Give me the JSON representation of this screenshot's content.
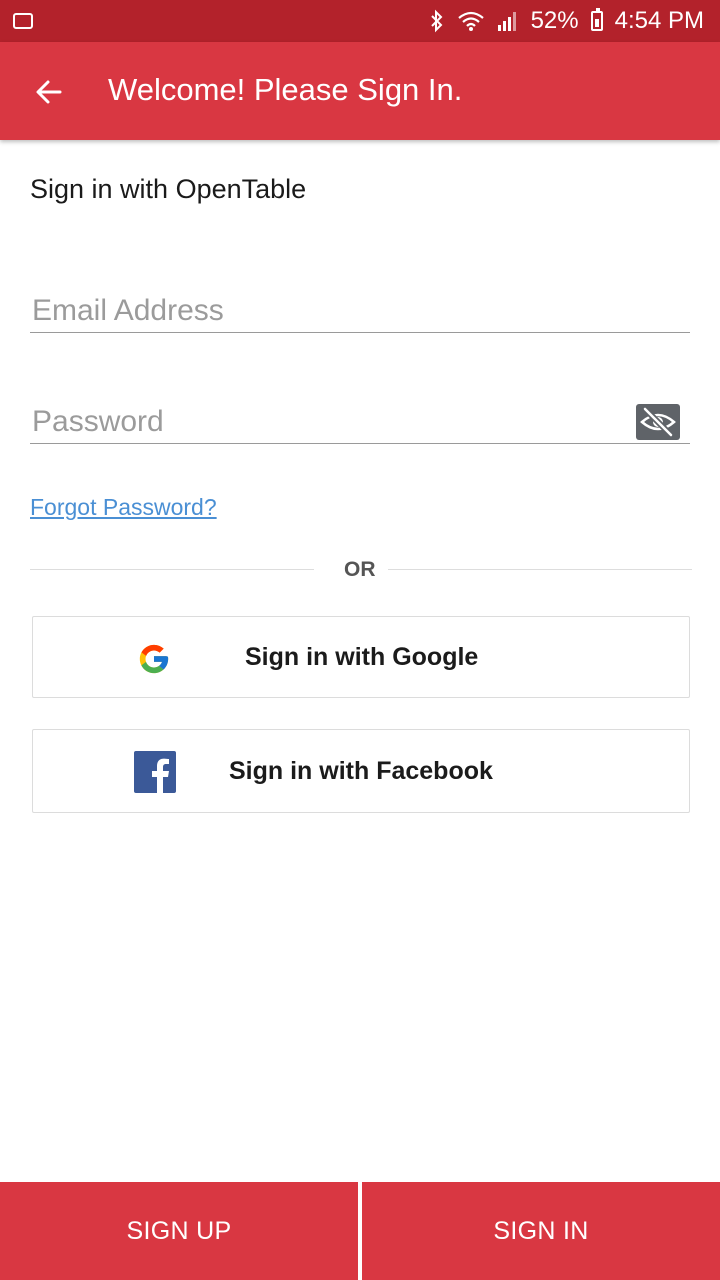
{
  "status_bar": {
    "battery_percent": "52%",
    "time": "4:54 PM",
    "icons": [
      "notification-icon",
      "bluetooth-icon",
      "wifi-icon",
      "signal-icon",
      "battery-icon"
    ]
  },
  "app_bar": {
    "title": "Welcome! Please Sign In.",
    "back_icon": "arrow-left-icon"
  },
  "form": {
    "subtitle": "Sign in with OpenTable",
    "email": {
      "placeholder": "Email Address",
      "value": ""
    },
    "password": {
      "placeholder": "Password",
      "value": ""
    },
    "password_toggle_icon": "eye-off-icon",
    "forgot_password": "Forgot Password?",
    "divider_text": "OR"
  },
  "social": {
    "google": {
      "label": "Sign in with Google",
      "icon": "google-logo-icon"
    },
    "facebook": {
      "label": "Sign in with Facebook",
      "icon": "facebook-logo-icon"
    }
  },
  "bottom_bar": {
    "sign_up": "SIGN UP",
    "sign_in": "SIGN IN"
  },
  "colors": {
    "status_bar": "#b3222b",
    "brand_red": "#d93742",
    "link_blue": "#4a8fd4",
    "facebook_blue": "#3b5998"
  }
}
